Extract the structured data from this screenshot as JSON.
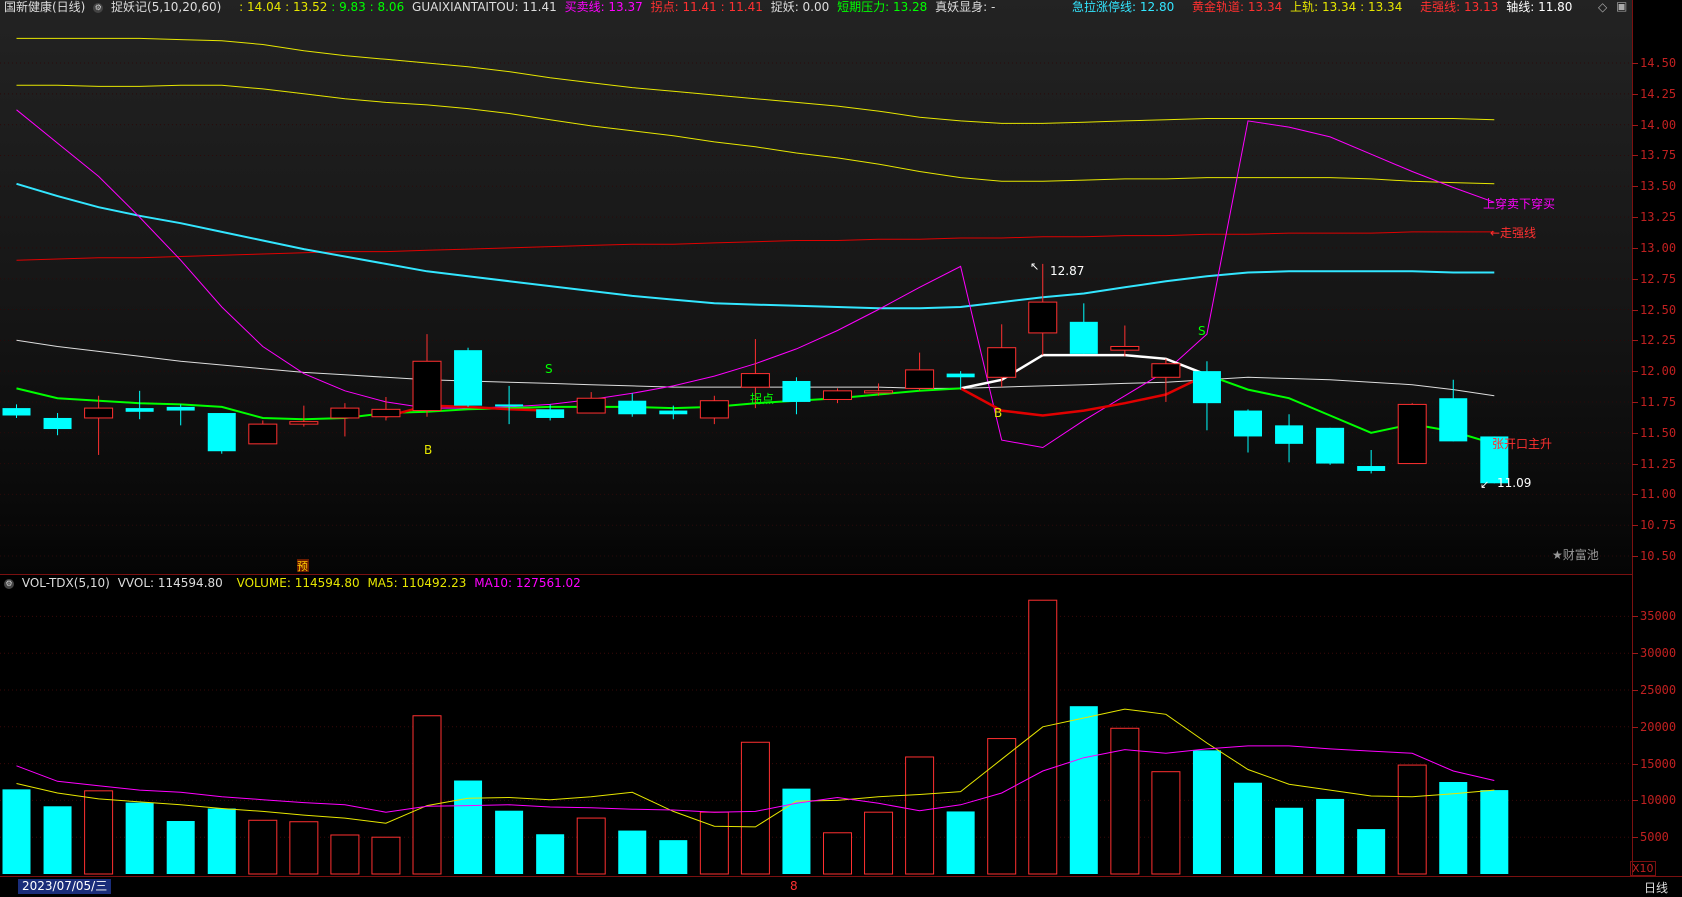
{
  "header": {
    "stock": "国新健康(日线)",
    "indicator": "捉妖记(5,10,20,60)",
    "v1": ": 14.04",
    "v2": ": 13.52",
    "v3": ": 9.83",
    "v4": ": 8.06",
    "guai_label": "GUAIXIANTAITOU: 11.41",
    "mmx": "买卖线: 13.37",
    "gd": "拐点: 11.41 : 11.41",
    "zy": "捉妖: 0.00",
    "dqyl": "短期压力: 13.28",
    "zyxs": "真妖显身: -",
    "jlzt": "急拉涨停线: 12.80",
    "hjgd": "黄金轨道: 13.34",
    "sg": "上轨: 13.34 : 13.34",
    "zqx": "走强线: 13.13",
    "zx": "轴线: 11.80"
  },
  "colors": {
    "up": "#ff3030",
    "down": "#00ffff",
    "yellow": "#e6e600",
    "magenta": "#ff00ff",
    "green": "#00ff00",
    "cyan_ma": "#33e6ff",
    "red_line": "#e00000",
    "white_line": "#ffffff",
    "grid": "#7a1010"
  },
  "price_axis": [
    "14.50",
    "14.25",
    "14.00",
    "13.75",
    "13.50",
    "13.25",
    "13.00",
    "12.75",
    "12.50",
    "12.25",
    "12.00",
    "11.75",
    "11.50",
    "11.25",
    "11.00",
    "10.75",
    "10.50"
  ],
  "vol_axis": [
    "35000",
    "30000",
    "25000",
    "20000",
    "15000",
    "10000",
    "5000"
  ],
  "annotations": {
    "high": "12.87",
    "low": "11.09",
    "right1": "上穿卖下穿买",
    "right2": "←走强线",
    "right3": "张开口主升",
    "guaidian": "拐点",
    "caifu": "★财富池",
    "yu": "预",
    "b": "B",
    "s": "S"
  },
  "vol_header": {
    "title": "VOL-TDX(5,10)",
    "vvol": "VVOL: 114594.80",
    "volume": "VOLUME: 114594.80",
    "ma5": "MA5: 110492.23",
    "ma10": "MA10: 127561.02"
  },
  "footer": {
    "date": "2023/07/05/三",
    "mid": "8",
    "x10": "X10",
    "period": "日线"
  },
  "chart_data": {
    "type": "candlestick",
    "ylim": [
      10.4,
      14.75
    ],
    "vol_ylim": [
      0,
      38500
    ],
    "candles": [
      {
        "o": 11.7,
        "c": 11.64,
        "h": 11.73,
        "l": 11.62,
        "v": 11500
      },
      {
        "o": 11.62,
        "c": 11.53,
        "h": 11.66,
        "l": 11.48,
        "v": 9200
      },
      {
        "o": 11.62,
        "c": 11.7,
        "h": 11.8,
        "l": 11.32,
        "v": 11300
      },
      {
        "o": 11.7,
        "c": 11.67,
        "h": 11.84,
        "l": 11.61,
        "v": 9700
      },
      {
        "o": 11.71,
        "c": 11.68,
        "h": 11.73,
        "l": 11.56,
        "v": 7200
      },
      {
        "o": 11.66,
        "c": 11.35,
        "h": 11.66,
        "l": 11.33,
        "v": 8900
      },
      {
        "o": 11.41,
        "c": 11.57,
        "h": 11.6,
        "l": 11.41,
        "v": 7300
      },
      {
        "o": 11.57,
        "c": 11.59,
        "h": 11.72,
        "l": 11.55,
        "v": 7100
      },
      {
        "o": 11.62,
        "c": 11.7,
        "h": 11.74,
        "l": 11.47,
        "v": 5300
      },
      {
        "o": 11.63,
        "c": 11.69,
        "h": 11.79,
        "l": 11.6,
        "v": 5000
      },
      {
        "o": 11.68,
        "c": 12.08,
        "h": 12.3,
        "l": 11.63,
        "v": 21500
      },
      {
        "o": 12.17,
        "c": 11.72,
        "h": 12.19,
        "l": 11.71,
        "v": 12700
      },
      {
        "o": 11.73,
        "c": 11.72,
        "h": 11.88,
        "l": 11.57,
        "v": 8600
      },
      {
        "o": 11.69,
        "c": 11.62,
        "h": 11.73,
        "l": 11.6,
        "v": 5400
      },
      {
        "o": 11.66,
        "c": 11.78,
        "h": 11.83,
        "l": 11.66,
        "v": 7600
      },
      {
        "o": 11.76,
        "c": 11.65,
        "h": 11.82,
        "l": 11.63,
        "v": 5900
      },
      {
        "o": 11.68,
        "c": 11.65,
        "h": 11.72,
        "l": 11.61,
        "v": 4600
      },
      {
        "o": 11.62,
        "c": 11.76,
        "h": 11.8,
        "l": 11.57,
        "v": 8400
      },
      {
        "o": 11.87,
        "c": 11.98,
        "h": 12.26,
        "l": 11.7,
        "v": 17900
      },
      {
        "o": 11.92,
        "c": 11.75,
        "h": 11.95,
        "l": 11.65,
        "v": 11600
      },
      {
        "o": 11.77,
        "c": 11.84,
        "h": 11.86,
        "l": 11.74,
        "v": 5600
      },
      {
        "o": 11.83,
        "c": 11.84,
        "h": 11.9,
        "l": 11.8,
        "v": 8400
      },
      {
        "o": 11.86,
        "c": 12.01,
        "h": 12.15,
        "l": 11.84,
        "v": 15900
      },
      {
        "o": 11.98,
        "c": 11.95,
        "h": 12.0,
        "l": 11.85,
        "v": 8500
      },
      {
        "o": 11.95,
        "c": 12.19,
        "h": 12.38,
        "l": 11.87,
        "v": 18400
      },
      {
        "o": 12.31,
        "c": 12.56,
        "h": 12.87,
        "l": 12.13,
        "v": 37200
      },
      {
        "o": 12.4,
        "c": 12.14,
        "h": 12.55,
        "l": 12.14,
        "v": 22800
      },
      {
        "o": 12.17,
        "c": 12.2,
        "h": 12.37,
        "l": 12.12,
        "v": 19800
      },
      {
        "o": 11.95,
        "c": 12.06,
        "h": 12.1,
        "l": 11.75,
        "v": 13900
      },
      {
        "o": 12.0,
        "c": 11.74,
        "h": 12.08,
        "l": 11.52,
        "v": 16800
      },
      {
        "o": 11.68,
        "c": 11.47,
        "h": 11.69,
        "l": 11.34,
        "v": 12400
      },
      {
        "o": 11.56,
        "c": 11.41,
        "h": 11.65,
        "l": 11.26,
        "v": 9000
      },
      {
        "o": 11.54,
        "c": 11.25,
        "h": 11.54,
        "l": 11.24,
        "v": 10200
      },
      {
        "o": 11.23,
        "c": 11.19,
        "h": 11.36,
        "l": 11.17,
        "v": 6100
      },
      {
        "o": 11.25,
        "c": 11.73,
        "h": 11.74,
        "l": 11.25,
        "v": 14800
      },
      {
        "o": 11.78,
        "c": 11.43,
        "h": 11.93,
        "l": 11.43,
        "v": 12500
      },
      {
        "o": 11.47,
        "c": 11.09,
        "h": 11.47,
        "l": 11.09,
        "v": 11400
      }
    ],
    "lines": {
      "yellow_top": [
        14.7,
        14.7,
        14.7,
        14.7,
        14.69,
        14.68,
        14.65,
        14.6,
        14.56,
        14.53,
        14.5,
        14.47,
        14.43,
        14.38,
        14.34,
        14.3,
        14.27,
        14.24,
        14.21,
        14.18,
        14.15,
        14.11,
        14.06,
        14.03,
        14.01,
        14.01,
        14.02,
        14.03,
        14.04,
        14.05,
        14.05,
        14.05,
        14.05,
        14.05,
        14.05,
        14.05,
        14.04
      ],
      "yellow_mid": [
        14.32,
        14.32,
        14.31,
        14.31,
        14.32,
        14.32,
        14.29,
        14.25,
        14.21,
        14.18,
        14.16,
        14.13,
        14.09,
        14.04,
        13.99,
        13.95,
        13.91,
        13.86,
        13.82,
        13.77,
        13.73,
        13.68,
        13.62,
        13.57,
        13.54,
        13.54,
        13.55,
        13.56,
        13.56,
        13.57,
        13.57,
        13.57,
        13.57,
        13.56,
        13.54,
        13.53,
        13.52
      ],
      "cyan": [
        13.52,
        13.42,
        13.33,
        13.26,
        13.2,
        13.13,
        13.06,
        12.99,
        12.93,
        12.87,
        12.81,
        12.77,
        12.73,
        12.69,
        12.65,
        12.61,
        12.58,
        12.55,
        12.54,
        12.53,
        12.52,
        12.51,
        12.51,
        12.52,
        12.56,
        12.6,
        12.63,
        12.68,
        12.73,
        12.77,
        12.8,
        12.81,
        12.81,
        12.81,
        12.81,
        12.8,
        12.8
      ],
      "red_zqx": [
        12.9,
        12.91,
        12.92,
        12.92,
        12.93,
        12.94,
        12.95,
        12.96,
        12.97,
        12.97,
        12.98,
        12.99,
        13.0,
        13.01,
        13.02,
        13.03,
        13.03,
        13.04,
        13.05,
        13.06,
        13.06,
        13.07,
        13.07,
        13.08,
        13.08,
        13.09,
        13.09,
        13.1,
        13.1,
        13.11,
        13.11,
        13.12,
        13.12,
        13.12,
        13.13,
        13.13,
        13.13
      ],
      "white": [
        12.25,
        12.2,
        12.16,
        12.12,
        12.08,
        12.05,
        12.02,
        11.99,
        11.97,
        11.95,
        11.93,
        11.92,
        11.91,
        11.9,
        11.89,
        11.88,
        11.87,
        11.87,
        11.87,
        11.87,
        11.87,
        11.87,
        11.86,
        11.86,
        11.87,
        11.88,
        11.89,
        11.9,
        11.91,
        11.93,
        11.95,
        11.94,
        11.93,
        11.91,
        11.89,
        11.85,
        11.8
      ],
      "magenta": [
        14.12,
        13.85,
        13.58,
        13.25,
        12.9,
        12.52,
        12.2,
        11.98,
        11.84,
        11.75,
        11.7,
        11.7,
        11.71,
        11.73,
        11.77,
        11.82,
        11.88,
        11.96,
        12.06,
        12.18,
        12.33,
        12.5,
        12.68,
        12.85,
        11.44,
        11.38,
        11.6,
        11.8,
        12.0,
        12.3,
        14.03,
        13.98,
        13.9,
        13.76,
        13.62,
        13.49,
        13.37
      ],
      "green": [
        11.86,
        11.78,
        11.76,
        11.74,
        11.73,
        11.71,
        11.62,
        11.61,
        11.62,
        11.66,
        11.67,
        11.69,
        11.7,
        11.71,
        11.71,
        11.71,
        11.7,
        11.71,
        11.74,
        11.76,
        11.78,
        11.81,
        11.84,
        11.86,
        null,
        null,
        null,
        null,
        null,
        11.97,
        11.85,
        11.78,
        11.64,
        11.5,
        11.57,
        11.51,
        11.41
      ],
      "white_thick": [
        null,
        null,
        null,
        null,
        null,
        null,
        null,
        null,
        null,
        null,
        null,
        null,
        null,
        null,
        null,
        null,
        null,
        null,
        null,
        null,
        null,
        null,
        null,
        11.86,
        11.93,
        12.13,
        12.13,
        12.13,
        12.1,
        11.97,
        null,
        null,
        null,
        null,
        null,
        null,
        null
      ],
      "red_thick": [
        null,
        null,
        null,
        null,
        null,
        null,
        null,
        null,
        null,
        11.63,
        11.72,
        11.71,
        11.69,
        11.68,
        null,
        null,
        null,
        null,
        null,
        null,
        null,
        null,
        null,
        11.86,
        11.68,
        11.64,
        11.68,
        11.74,
        11.81,
        11.97,
        null,
        null,
        null,
        null,
        null,
        null,
        null
      ]
    },
    "vol_ma5": [
      12300,
      11000,
      10200,
      9800,
      9400,
      8900,
      8500,
      8000,
      7600,
      6900,
      9300,
      10300,
      10400,
      10100,
      10500,
      11100,
      8500,
      6500,
      6400,
      9900,
      10000,
      10500,
      10800,
      11200,
      15600,
      20000,
      21200,
      22400,
      21700,
      17800,
      14200,
      12200,
      11400,
      10600,
      10500,
      10900,
      11400
    ],
    "vol_ma10": [
      14700,
      12600,
      12000,
      11400,
      11100,
      10500,
      10100,
      9700,
      9400,
      8400,
      9200,
      9300,
      9400,
      9100,
      9000,
      8800,
      8700,
      8400,
      8500,
      9600,
      10400,
      9600,
      8600,
      9400,
      11000,
      14000,
      15800,
      16900,
      16400,
      17000,
      17400,
      17400,
      17000,
      16700,
      16400,
      14000,
      12700
    ]
  }
}
